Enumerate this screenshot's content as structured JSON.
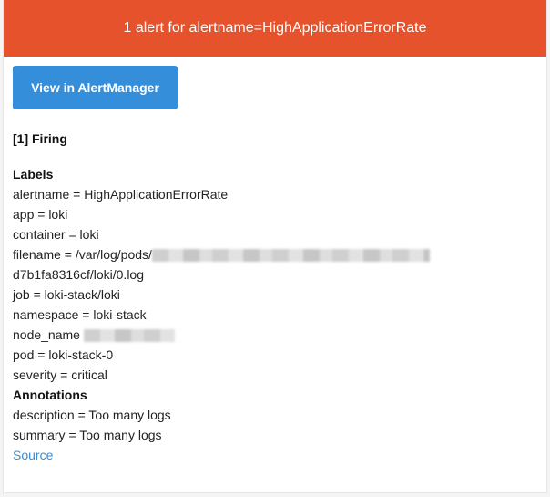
{
  "header": {
    "title": "1 alert for alertname=HighApplicationErrorRate"
  },
  "button": {
    "label": "View in AlertManager"
  },
  "status": {
    "label": "[1] Firing"
  },
  "labels": {
    "title": "Labels",
    "alertname": "alertname = HighApplicationErrorRate",
    "app": "app = loki",
    "container": "container = loki",
    "filename_prefix": "filename = /var/log/pods/",
    "filename_cont": "d7b1fa8316cf/loki/0.log",
    "job": "job = loki-stack/loki",
    "namespace": "namespace = loki-stack",
    "node_name": "node_name",
    "pod": "pod = loki-stack-0",
    "severity": "severity = critical"
  },
  "annotations": {
    "title": "Annotations",
    "description": "description = Too many logs",
    "summary": "summary = Too many logs"
  },
  "source": {
    "label": "Source"
  },
  "colors": {
    "header_bg": "#e6522c",
    "button_bg": "#348eda",
    "link": "#348eda"
  }
}
